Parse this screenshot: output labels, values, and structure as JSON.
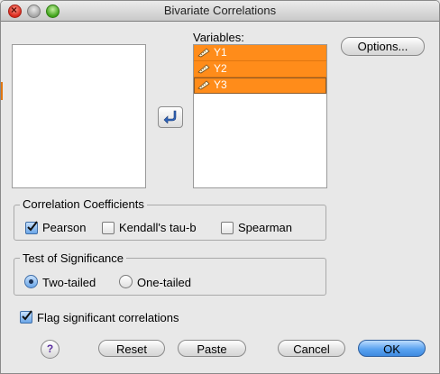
{
  "window": {
    "title": "Bivariate Correlations"
  },
  "variables": {
    "label": "Variables:",
    "items": [
      {
        "name": "Y1",
        "icon": "scale-ruler-icon"
      },
      {
        "name": "Y2",
        "icon": "scale-ruler-icon"
      },
      {
        "name": "Y3",
        "icon": "scale-ruler-icon"
      }
    ]
  },
  "buttons": {
    "options": "Options...",
    "reset": "Reset",
    "paste": "Paste",
    "cancel": "Cancel",
    "ok": "OK",
    "help": "?"
  },
  "correlation": {
    "title": "Correlation Coefficients",
    "pearson": {
      "label": "Pearson",
      "checked": true
    },
    "kendall": {
      "label": "Kendall's tau-b",
      "checked": false
    },
    "spearman": {
      "label": "Spearman",
      "checked": false
    }
  },
  "significance": {
    "title": "Test of Significance",
    "two_tailed": {
      "label": "Two-tailed",
      "selected": true
    },
    "one_tailed": {
      "label": "One-tailed",
      "selected": false
    }
  },
  "flag": {
    "label": "Flag significant correlations",
    "checked": true
  },
  "colors": {
    "selection": "#ff8c1a",
    "default_button": "#5aa3f0"
  }
}
